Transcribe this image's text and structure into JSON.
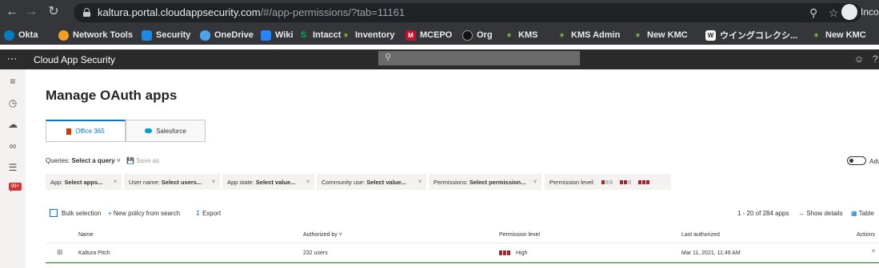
{
  "browser": {
    "url_host": "kaltura.portal.cloudappsecurity.com",
    "url_path": "/#/app-permissions/?tab=11161",
    "profile_label": "Inco",
    "bookmarks": [
      {
        "label": "Okta",
        "icon": "okta-icon",
        "color": "#007dc1"
      },
      {
        "label": "Network Tools",
        "icon": "network-tools-icon",
        "color": "#f2a024"
      },
      {
        "label": "Security",
        "icon": "security-icon",
        "color": "#1e88e5"
      },
      {
        "label": "OneDrive",
        "icon": "onedrive-icon",
        "color": "#4fa3e8"
      },
      {
        "label": "Wiki",
        "icon": "wiki-icon",
        "color": "#2684ff"
      },
      {
        "label": "Intacct",
        "icon": "intacct-icon",
        "color": "#00b050"
      },
      {
        "label": "Inventory",
        "icon": "inventory-icon",
        "color": "#7fbf3f"
      },
      {
        "label": "MCEPO",
        "icon": "mcepo-icon",
        "color": "#c8102e"
      },
      {
        "label": "Org",
        "icon": "github-icon",
        "color": "#111111"
      },
      {
        "label": "KMS",
        "icon": "kms-icon",
        "color": "#7fbf3f"
      },
      {
        "label": "KMS Admin",
        "icon": "kms-admin-icon",
        "color": "#7fbf3f"
      },
      {
        "label": "New KMC",
        "icon": "new-kmc-icon",
        "color": "#7fbf3f"
      },
      {
        "label": "ウイングコレクシ...",
        "icon": "wing-icon",
        "color": "#222222"
      },
      {
        "label": "New KMC",
        "icon": "new-kmc-icon",
        "color": "#7fbf3f"
      }
    ]
  },
  "app": {
    "title": "Cloud App Security",
    "search_icon": "search-icon",
    "page_title": "Manage OAuth apps"
  },
  "tabs": [
    {
      "label": "Office 365",
      "active": true
    },
    {
      "label": "Salesforce",
      "active": false
    }
  ],
  "queries": {
    "label": "Queries:",
    "value": "Select a query",
    "save_as": "Save as",
    "advanced_label": "Adv"
  },
  "filters": [
    {
      "label": "App:",
      "value": "Select apps..."
    },
    {
      "label": "User name:",
      "value": "Select users..."
    },
    {
      "label": "App state:",
      "value": "Select value..."
    },
    {
      "label": "Community use:",
      "value": "Select value..."
    },
    {
      "label": "Permissions:",
      "value": "Select permission..."
    },
    {
      "label": "Permission level:",
      "value": ""
    }
  ],
  "permission_level_colors": {
    "low": "#a4262c",
    "medium": "#a4262c",
    "high": "#a4262c",
    "off": "#c8c6c4"
  },
  "toolbar": {
    "bulk_selection": "Bulk selection",
    "new_policy": "New policy from search",
    "export": "Export",
    "count": "1 - 20 of 284 apps",
    "show_details": "Show details",
    "table_label": "Table"
  },
  "table": {
    "columns": [
      "Name",
      "Authorized by",
      "Permission level",
      "Last authorized",
      "Actions"
    ],
    "rows": [
      {
        "name": "Kaltura Pitch",
        "authorized_by": "232 users",
        "permission_level": "High",
        "last_authorized": "Mar 11, 2021, 11:49 AM"
      }
    ]
  }
}
